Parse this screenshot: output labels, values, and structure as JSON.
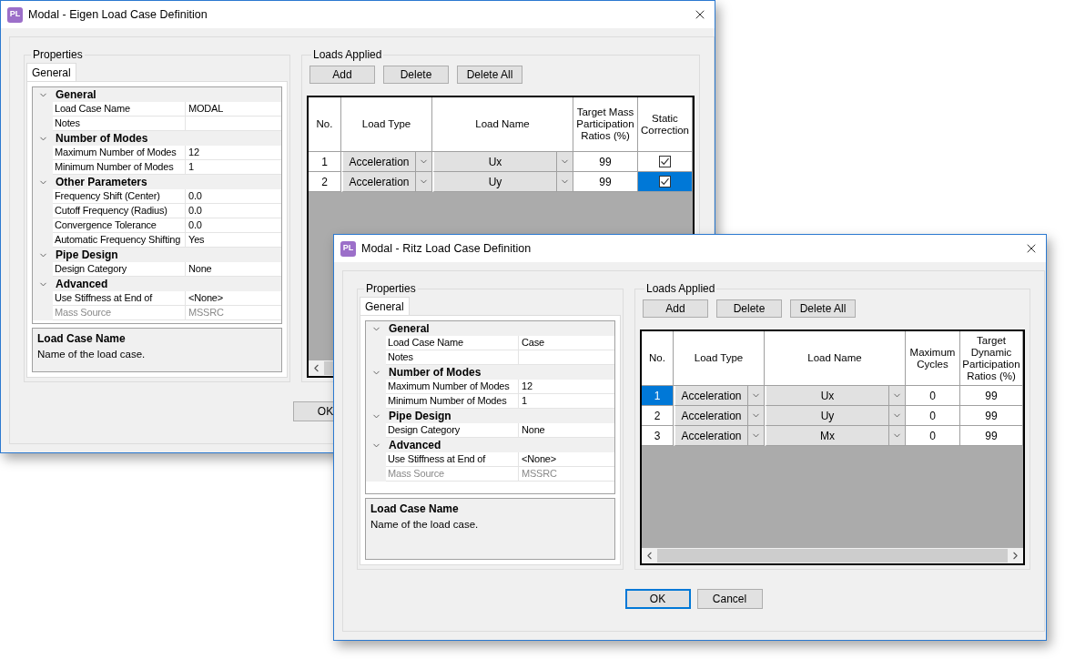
{
  "windows": [
    {
      "title": "Modal - Eigen Load Case Definition",
      "icon_text": "PL",
      "properties": {
        "label": "Properties",
        "tabs": [
          {
            "label": "General",
            "selected": true
          }
        ],
        "categories": [
          {
            "name": "General",
            "expanded": true,
            "properties": [
              {
                "name": "Load Case Name",
                "value": "MODAL",
                "disabled": false
              },
              {
                "name": "Notes",
                "disabled": false
              }
            ]
          },
          {
            "name": "Number of Modes",
            "expanded": true,
            "properties": [
              {
                "name": "Maximum Number of Modes",
                "value": "12",
                "disabled": false
              },
              {
                "name": "Minimum Number of Modes",
                "value": "1",
                "disabled": false
              }
            ]
          },
          {
            "name": "Other Parameters",
            "expanded": true,
            "properties": [
              {
                "name": "Frequency Shift (Center)",
                "value": "0.0",
                "disabled": false
              },
              {
                "name": "Cutoff Frequency (Radius)",
                "value": "0.0",
                "disabled": false
              },
              {
                "name": "Convergence Tolerance",
                "value": "0.0",
                "disabled": false
              },
              {
                "name": "Automatic Frequency Shifting",
                "value": "Yes",
                "disabled": false
              }
            ]
          },
          {
            "name": "Pipe Design",
            "expanded": true,
            "properties": [
              {
                "name": "Design Category",
                "value": "None",
                "disabled": false
              }
            ]
          },
          {
            "name": "Advanced",
            "expanded": true,
            "properties": [
              {
                "name": "Use Stiffness at End of",
                "value": "<None>",
                "disabled": false
              },
              {
                "name": "Mass Source",
                "value": "MSSRC",
                "disabled": true
              }
            ]
          }
        ],
        "description": {
          "title": "Load Case Name",
          "text": "Name of the load case."
        }
      },
      "loads": {
        "label": "Loads Applied",
        "buttons": [
          "Add",
          "Delete",
          "Delete All"
        ],
        "table": {
          "columns": [
            "No.",
            "Load Type",
            "Load Name",
            "Target Mass Participation Ratios (%)",
            "Static Correction"
          ],
          "rows": [
            {
              "cells": [
                {
                  "kind": "number",
                  "value": "1",
                  "selected": false
                },
                {
                  "kind": "dropdown",
                  "value": "Acceleration",
                  "selected": false
                },
                {
                  "kind": "dropdown",
                  "value": "Ux",
                  "selected": false
                },
                {
                  "kind": "text",
                  "value": "99",
                  "selected": false
                },
                {
                  "kind": "checkbox",
                  "checked": true,
                  "selected": false
                }
              ]
            },
            {
              "cells": [
                {
                  "kind": "number",
                  "value": "2",
                  "selected": false
                },
                {
                  "kind": "dropdown",
                  "value": "Acceleration",
                  "selected": false
                },
                {
                  "kind": "dropdown",
                  "value": "Uy",
                  "selected": false
                },
                {
                  "kind": "text",
                  "value": "99",
                  "selected": false
                },
                {
                  "kind": "checkbox",
                  "checked": true,
                  "selected": true
                }
              ]
            }
          ]
        }
      },
      "buttons": [
        {
          "label": "OK",
          "default": false
        }
      ]
    },
    {
      "title": "Modal - Ritz Load Case Definition",
      "icon_text": "PL",
      "properties": {
        "label": "Properties",
        "tabs": [
          {
            "label": "General",
            "selected": true
          }
        ],
        "categories": [
          {
            "name": "General",
            "expanded": true,
            "properties": [
              {
                "name": "Load Case Name",
                "value": "Case",
                "disabled": false
              },
              {
                "name": "Notes",
                "disabled": false
              }
            ]
          },
          {
            "name": "Number of Modes",
            "expanded": true,
            "properties": [
              {
                "name": "Maximum Number of Modes",
                "value": "12",
                "disabled": false
              },
              {
                "name": "Minimum Number of Modes",
                "value": "1",
                "disabled": false
              }
            ]
          },
          {
            "name": "Pipe Design",
            "expanded": true,
            "properties": [
              {
                "name": "Design Category",
                "value": "None",
                "disabled": false
              }
            ]
          },
          {
            "name": "Advanced",
            "expanded": true,
            "properties": [
              {
                "name": "Use Stiffness at End of",
                "value": "<None>",
                "disabled": false
              },
              {
                "name": "Mass Source",
                "value": "MSSRC",
                "disabled": true
              }
            ]
          }
        ],
        "description": {
          "title": "Load Case Name",
          "text": "Name of the load case."
        }
      },
      "loads": {
        "label": "Loads Applied",
        "buttons": [
          "Add",
          "Delete",
          "Delete All"
        ],
        "table": {
          "columns": [
            "No.",
            "Load Type",
            "Load Name",
            "Maximum Cycles",
            "Target Dynamic Participation Ratios (%)"
          ],
          "rows": [
            {
              "cells": [
                {
                  "kind": "number",
                  "value": "1",
                  "selected": true
                },
                {
                  "kind": "dropdown",
                  "value": "Acceleration",
                  "selected": false
                },
                {
                  "kind": "dropdown",
                  "value": "Ux",
                  "selected": false
                },
                {
                  "kind": "text",
                  "value": "0",
                  "selected": false
                },
                {
                  "kind": "text",
                  "value": "99",
                  "selected": false
                }
              ]
            },
            {
              "cells": [
                {
                  "kind": "number",
                  "value": "2",
                  "selected": false
                },
                {
                  "kind": "dropdown",
                  "value": "Acceleration",
                  "selected": false
                },
                {
                  "kind": "dropdown",
                  "value": "Uy",
                  "selected": false
                },
                {
                  "kind": "text",
                  "value": "0",
                  "selected": false
                },
                {
                  "kind": "text",
                  "value": "99",
                  "selected": false
                }
              ]
            },
            {
              "cells": [
                {
                  "kind": "number",
                  "value": "3",
                  "selected": false
                },
                {
                  "kind": "dropdown",
                  "value": "Acceleration",
                  "selected": false
                },
                {
                  "kind": "dropdown",
                  "value": "Mx",
                  "selected": false
                },
                {
                  "kind": "text",
                  "value": "0",
                  "selected": false
                },
                {
                  "kind": "text",
                  "value": "99",
                  "selected": false
                }
              ]
            }
          ]
        }
      },
      "buttons": [
        {
          "label": "OK",
          "default": true
        },
        {
          "label": "Cancel",
          "default": false
        }
      ]
    }
  ]
}
